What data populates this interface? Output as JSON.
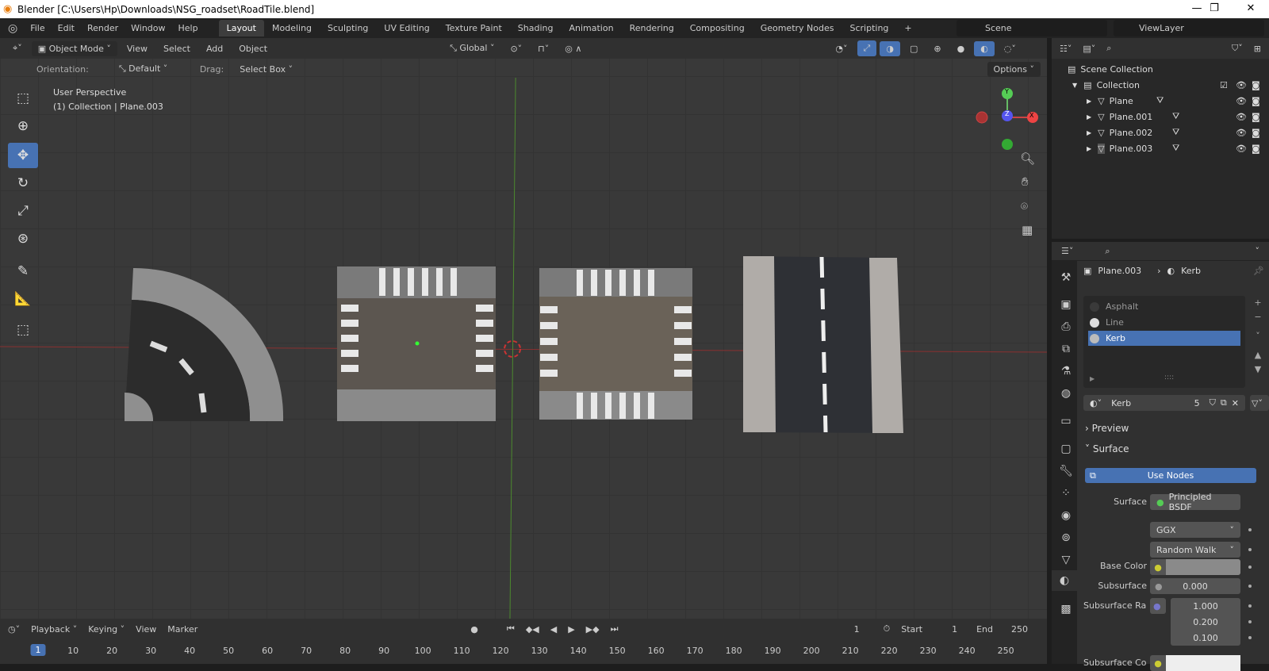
{
  "window": {
    "title": "Blender [C:\\Users\\Hp\\Downloads\\NSG_roadset\\RoadTile.blend]",
    "minimize": "—",
    "maximize": "❐",
    "close": "✕"
  },
  "menu": [
    "File",
    "Edit",
    "Render",
    "Window",
    "Help"
  ],
  "workspaces": [
    "Layout",
    "Modeling",
    "Sculpting",
    "UV Editing",
    "Texture Paint",
    "Shading",
    "Animation",
    "Rendering",
    "Compositing",
    "Geometry Nodes",
    "Scripting",
    "+"
  ],
  "scene": {
    "scene": "Scene",
    "view_layer": "ViewLayer"
  },
  "viewport_header": {
    "mode": "Object Mode",
    "view": "View",
    "select": "Select",
    "add": "Add",
    "object": "Object",
    "transform": "Global"
  },
  "tool_settings": {
    "orientation_label": "Orientation:",
    "orientation": "Default",
    "drag_label": "Drag:",
    "drag": "Select Box",
    "options": "Options"
  },
  "viewport": {
    "perspective": "User Perspective",
    "context": "(1) Collection | Plane.003",
    "gizmo": {
      "x": "X",
      "y": "Y",
      "z": "Z"
    }
  },
  "outliner": {
    "root": "Scene Collection",
    "collection": "Collection",
    "objects": [
      "Plane",
      "Plane.001",
      "Plane.002",
      "Plane.003"
    ]
  },
  "properties": {
    "object": "Plane.003",
    "material": "Kerb",
    "slots": [
      "Asphalt",
      "Line",
      "Kerb"
    ],
    "material_users": "5",
    "preview": "Preview",
    "surface_panel": "Surface",
    "use_nodes": "Use Nodes",
    "surface_label": "Surface",
    "surface_value": "Principled BSDF",
    "distribution": "GGX",
    "subsurface_method": "Random Walk",
    "base_color_label": "Base Color",
    "base_color": "#8a8a8a",
    "subsurface_label": "Subsurface",
    "subsurface": "0.000",
    "subsurface_radius_label": "Subsurface Ra",
    "subsurface_radius": [
      "1.000",
      "0.200",
      "0.100"
    ],
    "subsurface_color_label": "Subsurface Co"
  },
  "timeline": {
    "playback": "Playback",
    "keying": "Keying",
    "view": "View",
    "marker": "Marker",
    "current_frame": "1",
    "start_label": "Start",
    "start": "1",
    "end_label": "End",
    "end": "250",
    "ruler": [
      "1",
      "10",
      "20",
      "30",
      "40",
      "50",
      "60",
      "70",
      "80",
      "90",
      "100",
      "110",
      "120",
      "130",
      "140",
      "150",
      "160",
      "170",
      "180",
      "190",
      "200",
      "210",
      "220",
      "230",
      "240",
      "250"
    ]
  },
  "colors": {
    "accent": "#4772b3",
    "active_tab": "#3d3d3d"
  }
}
